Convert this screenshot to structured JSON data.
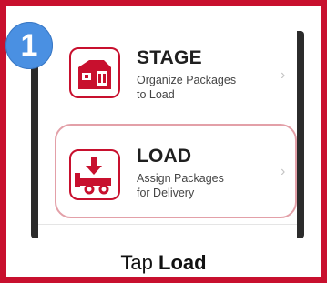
{
  "step": {
    "number": "1"
  },
  "menu": {
    "items": [
      {
        "title": "STAGE",
        "subtitle_line1": "Organize Packages",
        "subtitle_line2": "to Load",
        "icon": "stage-building-icon"
      },
      {
        "title": "LOAD",
        "subtitle_line1": "Assign Packages",
        "subtitle_line2": "for Delivery",
        "icon": "load-truck-icon"
      }
    ],
    "chevron": "›"
  },
  "caption": {
    "prefix": "Tap ",
    "bold": "Load"
  },
  "colors": {
    "brand_red": "#c8102e",
    "badge_blue": "#4a90e2"
  }
}
